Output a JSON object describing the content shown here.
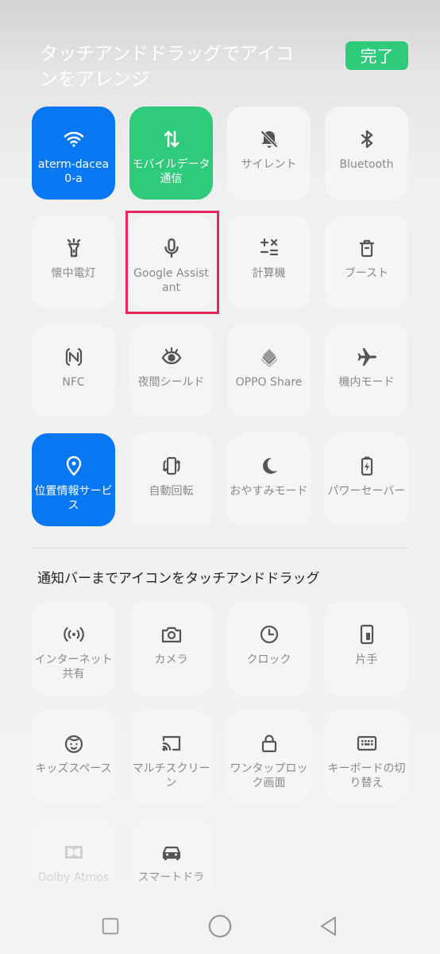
{
  "header": {
    "title": "タッチアンドドラッグでアイコンをアレンジ",
    "done_label": "完了"
  },
  "active_tiles": [
    {
      "label": "aterm-dacea0-a",
      "icon": "wifi-icon",
      "state": "blue"
    },
    {
      "label": "モバイルデータ通信",
      "icon": "mobile-data-icon",
      "state": "green"
    },
    {
      "label": "サイレント",
      "icon": "bell-off-icon",
      "state": "off"
    },
    {
      "label": "Bluetooth",
      "icon": "bluetooth-icon",
      "state": "off"
    },
    {
      "label": "懐中電灯",
      "icon": "flashlight-icon",
      "state": "off"
    },
    {
      "label": "Google Assistant",
      "icon": "microphone-icon",
      "state": "off"
    },
    {
      "label": "計算機",
      "icon": "calculator-icon",
      "state": "off"
    },
    {
      "label": "ブースト",
      "icon": "boost-icon",
      "state": "off"
    },
    {
      "label": "NFC",
      "icon": "nfc-icon",
      "state": "off"
    },
    {
      "label": "夜間シールド",
      "icon": "eye-icon",
      "state": "off"
    },
    {
      "label": "OPPO Share",
      "icon": "oppo-share-icon",
      "state": "off"
    },
    {
      "label": "機内モード",
      "icon": "airplane-icon",
      "state": "off"
    },
    {
      "label": "位置情報サービス",
      "icon": "location-icon",
      "state": "blue"
    },
    {
      "label": "自動回転",
      "icon": "auto-rotate-icon",
      "state": "off"
    },
    {
      "label": "おやすみモード",
      "icon": "moon-icon",
      "state": "off"
    },
    {
      "label": "パワーセーバー",
      "icon": "battery-icon",
      "state": "off"
    }
  ],
  "section2_title": "通知バーまでアイコンをタッチアンドドラッグ",
  "available_tiles": [
    {
      "label": "インターネット共有",
      "icon": "hotspot-icon"
    },
    {
      "label": "カメラ",
      "icon": "camera-icon"
    },
    {
      "label": "クロック",
      "icon": "clock-icon"
    },
    {
      "label": "片手",
      "icon": "one-hand-icon"
    },
    {
      "label": "キッズスペース",
      "icon": "kids-space-icon"
    },
    {
      "label": "マルチスクリーン",
      "icon": "cast-icon"
    },
    {
      "label": "ワンタップロック画面",
      "icon": "lock-icon"
    },
    {
      "label": "キーボードの切り替え",
      "icon": "keyboard-icon"
    },
    {
      "label": "Dolby Atmos",
      "icon": "dolby-icon"
    },
    {
      "label": "スマートドラ",
      "icon": "car-icon"
    }
  ],
  "colors": {
    "blue": "#0877f3",
    "green": "#2ecb7a",
    "highlight": "#e8265e"
  },
  "navbar": {
    "icons": [
      "recent-apps-icon",
      "home-icon",
      "back-icon"
    ]
  }
}
